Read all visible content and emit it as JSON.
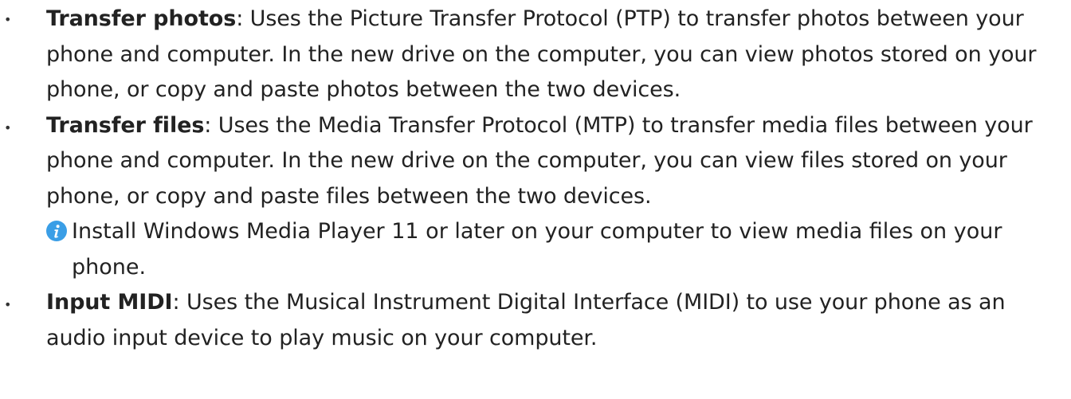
{
  "items": [
    {
      "term": "Transfer photos",
      "text": ": Uses the Picture Transfer Protocol (PTP) to transfer photos between your phone and computer. In the new drive on the computer, you can view photos stored on your phone, or copy and paste photos between the two devices."
    },
    {
      "term": "Transfer files",
      "text": ": Uses the Media Transfer Protocol (MTP) to transfer media files between your phone and computer. In the new drive on the computer, you can view files stored on your phone, or copy and paste files between the two devices."
    },
    {
      "term": "Input MIDI",
      "text": ": Uses the Musical Instrument Digital Interface (MIDI) to use your phone as an audio input device to play music on your computer."
    }
  ],
  "note": {
    "icon": "info-icon",
    "text": "Install Windows Media Player 11 or later on your computer to view media files on your phone."
  },
  "colors": {
    "text": "#222222",
    "info_icon_fill": "#3a9ee6",
    "info_icon_glyph": "#ffffff"
  },
  "bullet_glyph": "•"
}
